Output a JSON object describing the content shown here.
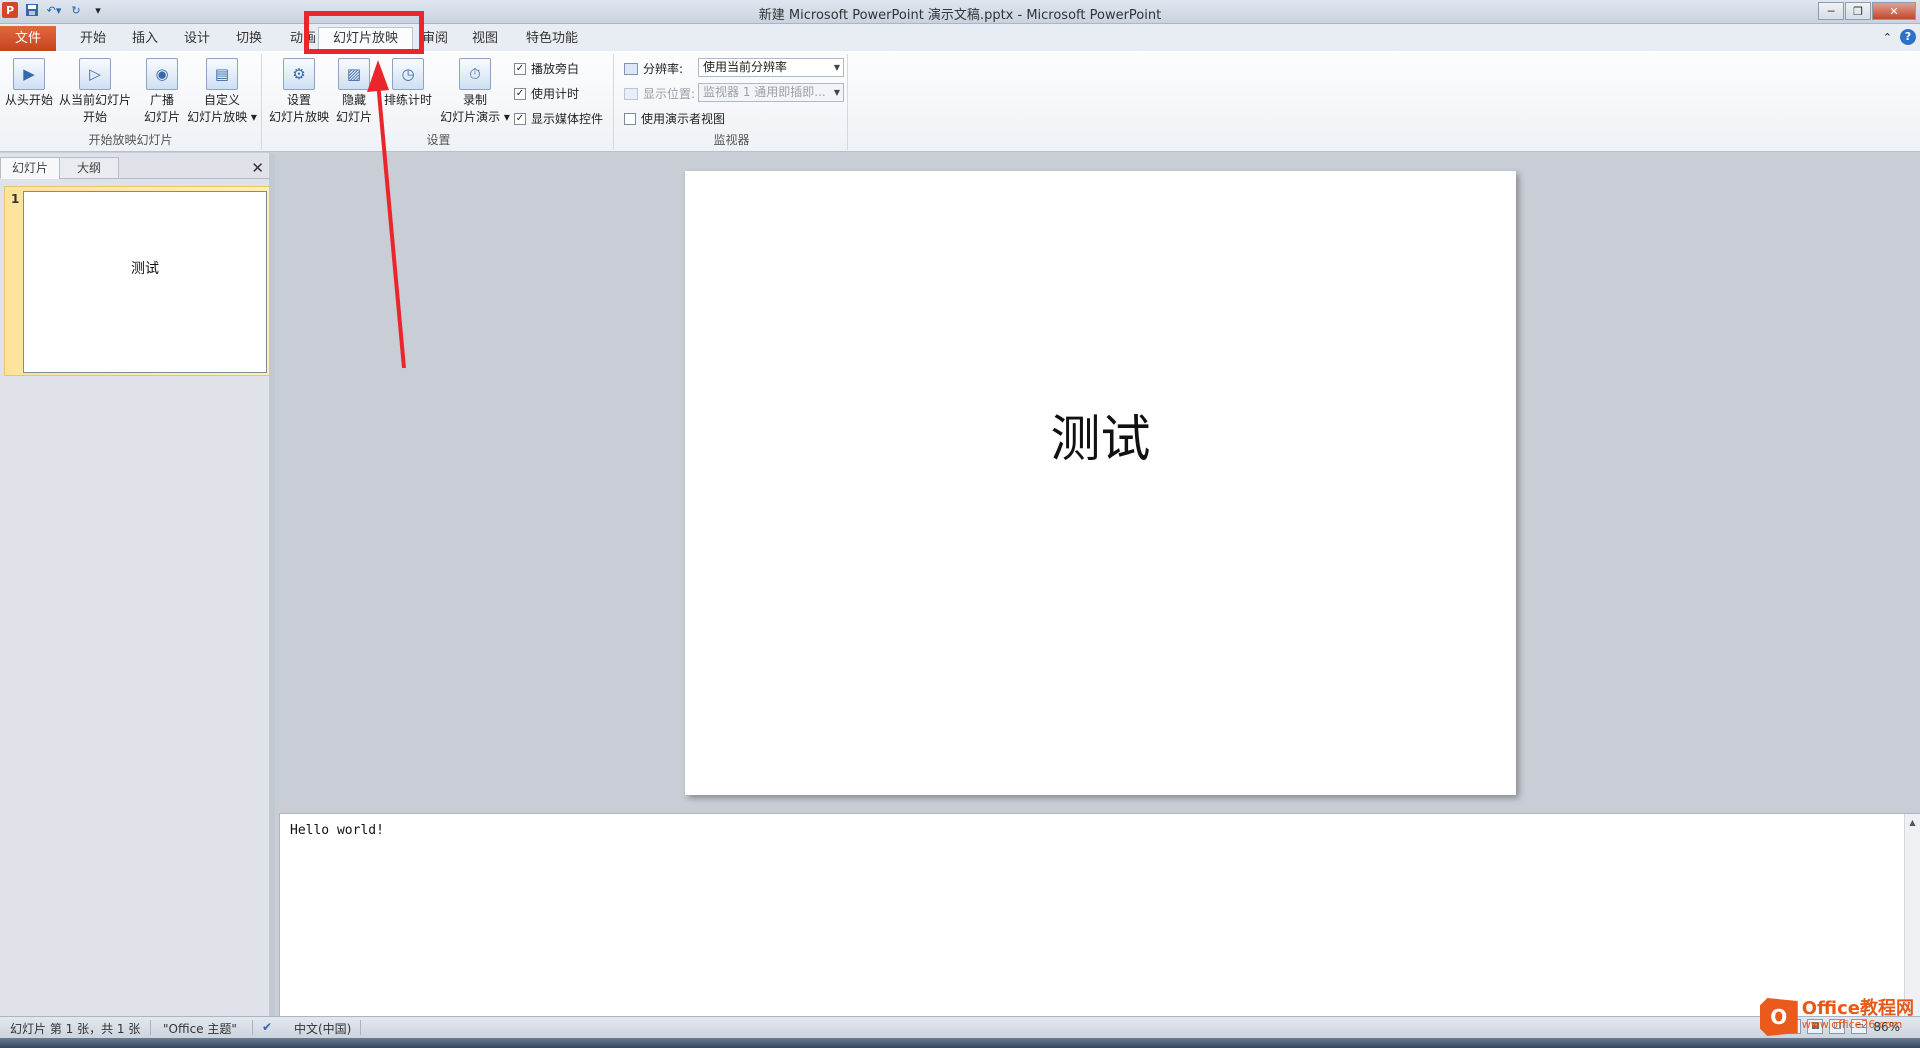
{
  "window": {
    "title": "新建 Microsoft PowerPoint 演示文稿.pptx  -  Microsoft PowerPoint",
    "app_icon_letter": "P",
    "controls": [
      "─",
      "❐",
      "✕"
    ]
  },
  "ribbon_tabs": [
    "文件",
    "开始",
    "插入",
    "设计",
    "切换",
    "动画",
    "幻灯片放映",
    "审阅",
    "视图",
    "特色功能"
  ],
  "ribbon": {
    "start_group": {
      "label": "开始放映幻灯片",
      "from_beginning": "从头开始",
      "from_current_1": "从当前幻灯片",
      "from_current_2": "开始",
      "broadcast_1": "广播",
      "broadcast_2": "幻灯片",
      "custom_1": "自定义",
      "custom_2": "幻灯片放映 ▾"
    },
    "setup_group": {
      "label": "设置",
      "setup_1": "设置",
      "setup_2": "幻灯片放映",
      "hide_1": "隐藏",
      "hide_2": "幻灯片",
      "rehearse": "排练计时",
      "record_1": "录制",
      "record_2": "幻灯片演示 ▾",
      "play_narrations": "播放旁白",
      "use_timings": "使用计时",
      "show_media_controls": "显示媒体控件"
    },
    "monitor_group": {
      "label": "监视器",
      "resolution_label": "分辨率:",
      "resolution_value": "使用当前分辨率",
      "show_on_label": "显示位置:",
      "show_on_value": "监视器 1  通用即插即...",
      "presenter_view": "使用演示者视图"
    }
  },
  "panel": {
    "tab_slides": "幻灯片",
    "tab_outline": "大纲",
    "close": "✕",
    "thumb_number": "1",
    "thumb_text": "测试"
  },
  "slide": {
    "title": "测试"
  },
  "notes": {
    "text": "Hello world!"
  },
  "status": {
    "slide_info": "幻灯片 第 1 张，共 1 张",
    "theme": "\"Office 主题\"",
    "language": "中文(中国)",
    "zoom": "86%"
  },
  "watermark": {
    "logo": "O",
    "main": "Office教程网",
    "sub": "www.office26.com"
  },
  "colors": {
    "accent_file_tab": "#d24726",
    "annotation": "#e8262b"
  }
}
